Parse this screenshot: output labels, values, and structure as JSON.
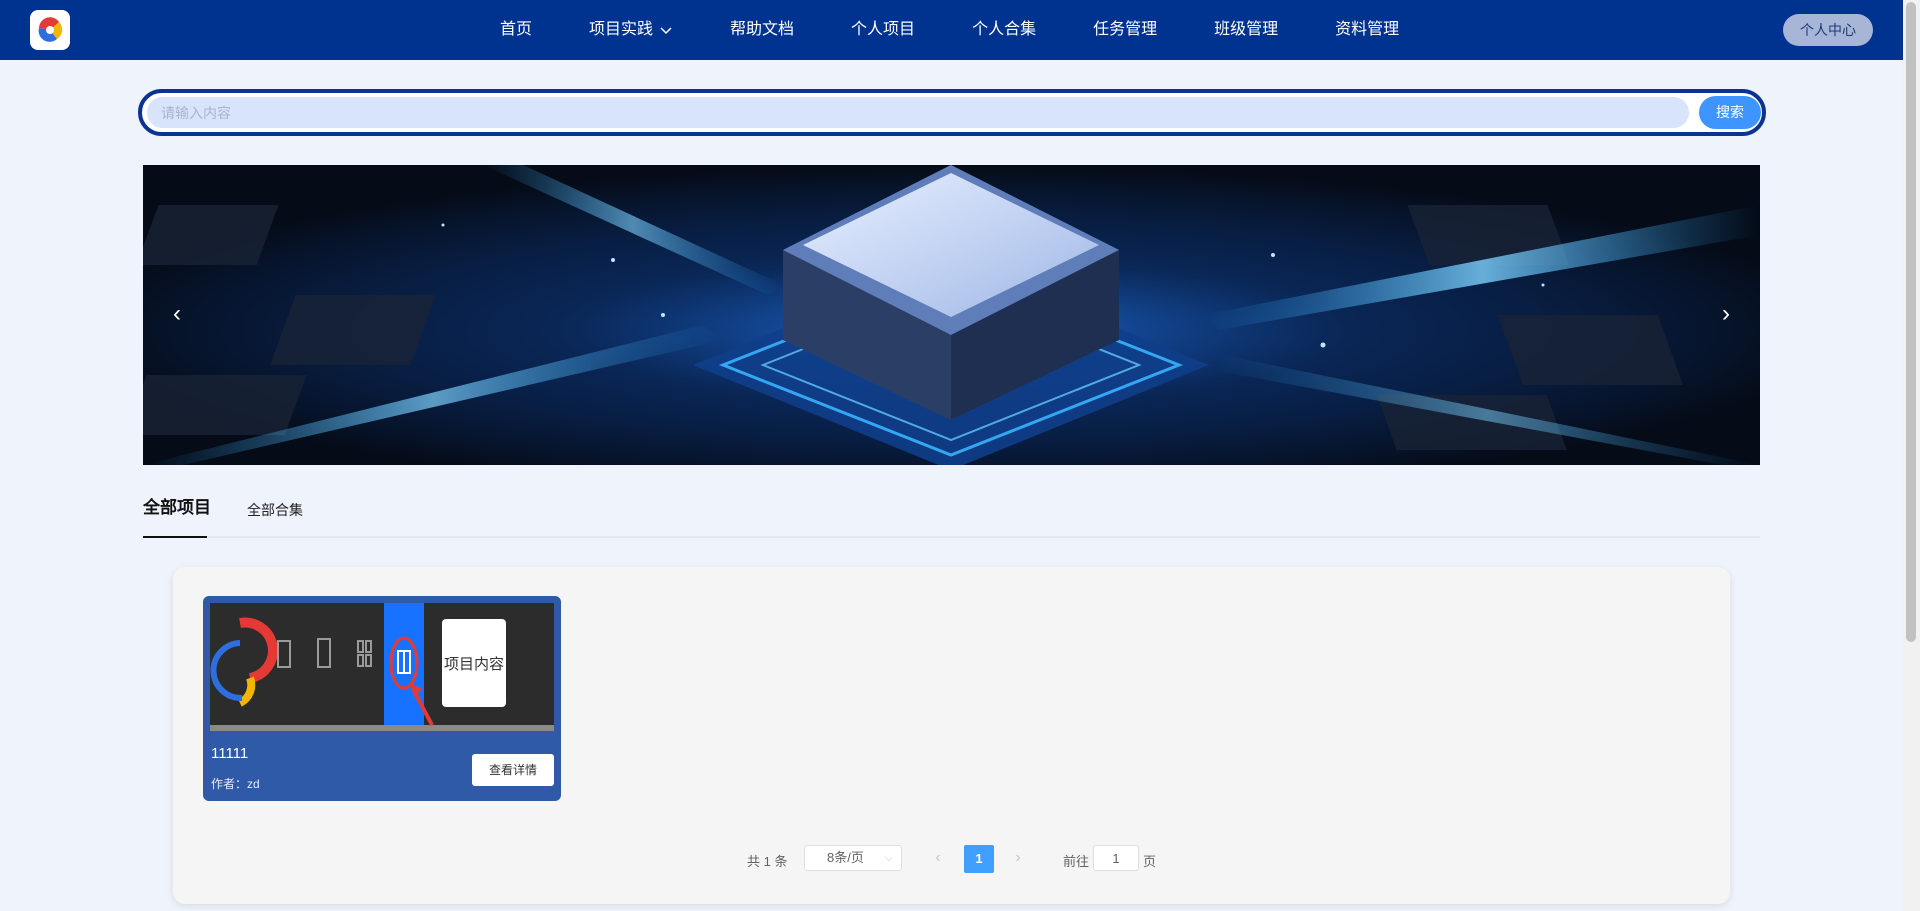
{
  "nav": {
    "items": [
      {
        "label": "首页"
      },
      {
        "label": "项目实践",
        "has_dropdown": true
      },
      {
        "label": "帮助文档"
      },
      {
        "label": "个人项目"
      },
      {
        "label": "个人合集"
      },
      {
        "label": "任务管理"
      },
      {
        "label": "班级管理"
      },
      {
        "label": "资料管理"
      }
    ],
    "user_center": "个人中心"
  },
  "search": {
    "placeholder": "请输入内容",
    "button": "搜索"
  },
  "banner": {
    "prev": "‹",
    "next": "›"
  },
  "tabs": [
    {
      "label": "全部项目",
      "active": true
    },
    {
      "label": "全部合集",
      "active": false
    }
  ],
  "projects": [
    {
      "title": "11111",
      "author": "作者：zd",
      "detail_button": "查看详情",
      "thumbnail_text": "项目内容"
    }
  ],
  "pagination": {
    "total": "共 1 条",
    "page_size": "8条/页",
    "current_page": "1",
    "goto_label": "前往",
    "goto_value": "1",
    "page_suffix": "页"
  },
  "colors": {
    "nav_bg": "#003390",
    "accent": "#409eff",
    "card_bg": "#2f5aa8",
    "page_bg": "#eff3fb"
  }
}
